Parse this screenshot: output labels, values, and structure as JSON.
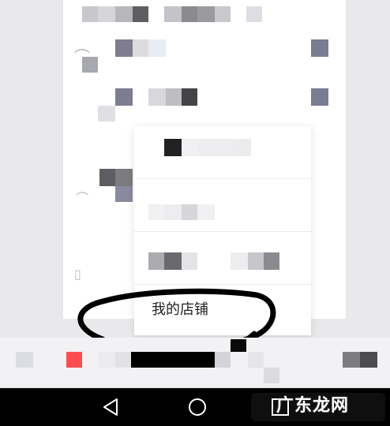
{
  "popup_menu": {
    "items": [
      {
        "label": ""
      },
      {
        "label": ""
      },
      {
        "label": ""
      },
      {
        "label": "我的店铺"
      }
    ]
  },
  "watermark": {
    "text": "广东龙网"
  },
  "colors": {
    "background": "#e9e9eb",
    "card": "#ffffff",
    "accent_red": "#ff4d4f",
    "navbar": "#000000"
  },
  "icons": [
    "back-icon",
    "home-icon",
    "recent-apps-icon"
  ]
}
